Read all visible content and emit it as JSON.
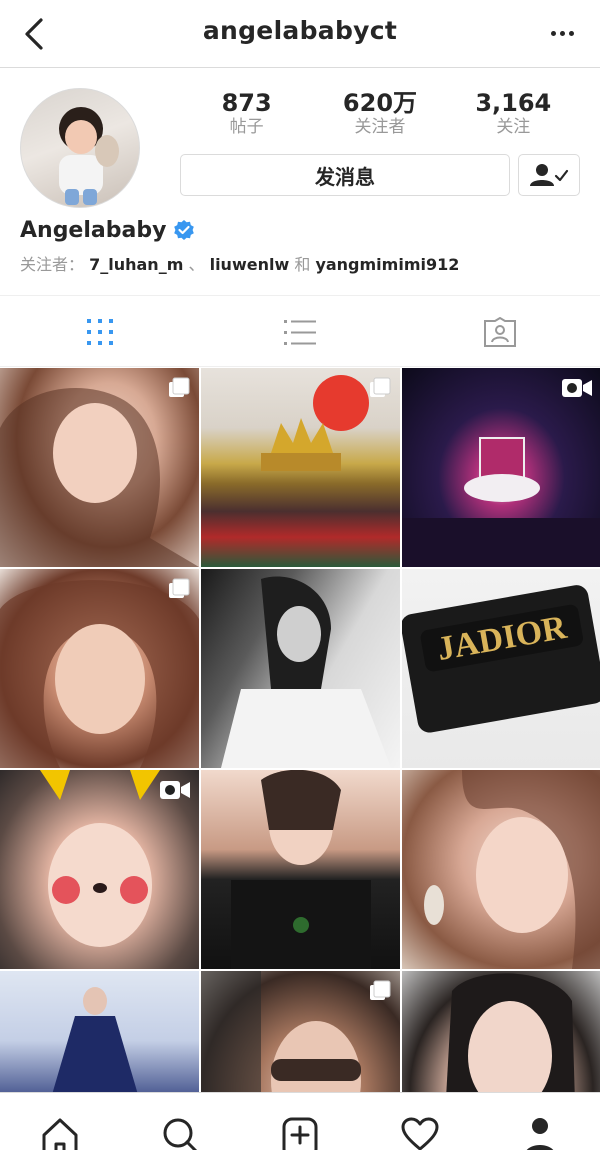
{
  "header": {
    "username": "angelababyct"
  },
  "profile": {
    "stats": [
      {
        "value": "873",
        "label": "帖子"
      },
      {
        "value": "620万",
        "label": "关注者"
      },
      {
        "value": "3,164",
        "label": "关注"
      }
    ],
    "message_button": "发消息",
    "display_name": "Angelababy",
    "verified": true,
    "followed_by_prefix": "关注者：",
    "followed_by_users": [
      "7_luhan_m",
      "liuwenlw",
      "yangmimimi912"
    ],
    "followed_by_sep1": "、",
    "followed_by_sep2": "和"
  },
  "tabs": [
    {
      "id": "grid",
      "icon": "grid-icon",
      "active": true
    },
    {
      "id": "list",
      "icon": "list-icon",
      "active": false
    },
    {
      "id": "tagged",
      "icon": "tagged-icon",
      "active": false
    }
  ],
  "grid_items": [
    {
      "badge": "multi"
    },
    {
      "badge": "multi",
      "text": ""
    },
    {
      "badge": "video"
    },
    {
      "badge": "multi"
    },
    {
      "badge": "none"
    },
    {
      "badge": "none",
      "text": "JADIOR"
    },
    {
      "badge": "video"
    },
    {
      "badge": "none"
    },
    {
      "badge": "none"
    },
    {
      "badge": "none"
    },
    {
      "badge": "multi"
    },
    {
      "badge": "none"
    }
  ],
  "bottom_nav": [
    {
      "icon": "home-icon"
    },
    {
      "icon": "search-icon"
    },
    {
      "icon": "add-post-icon"
    },
    {
      "icon": "heart-icon"
    },
    {
      "icon": "profile-icon",
      "active": true
    }
  ],
  "colors": {
    "accent_blue": "#3897f0",
    "text": "#262626",
    "muted": "#999999",
    "border": "#dbdbdb"
  }
}
